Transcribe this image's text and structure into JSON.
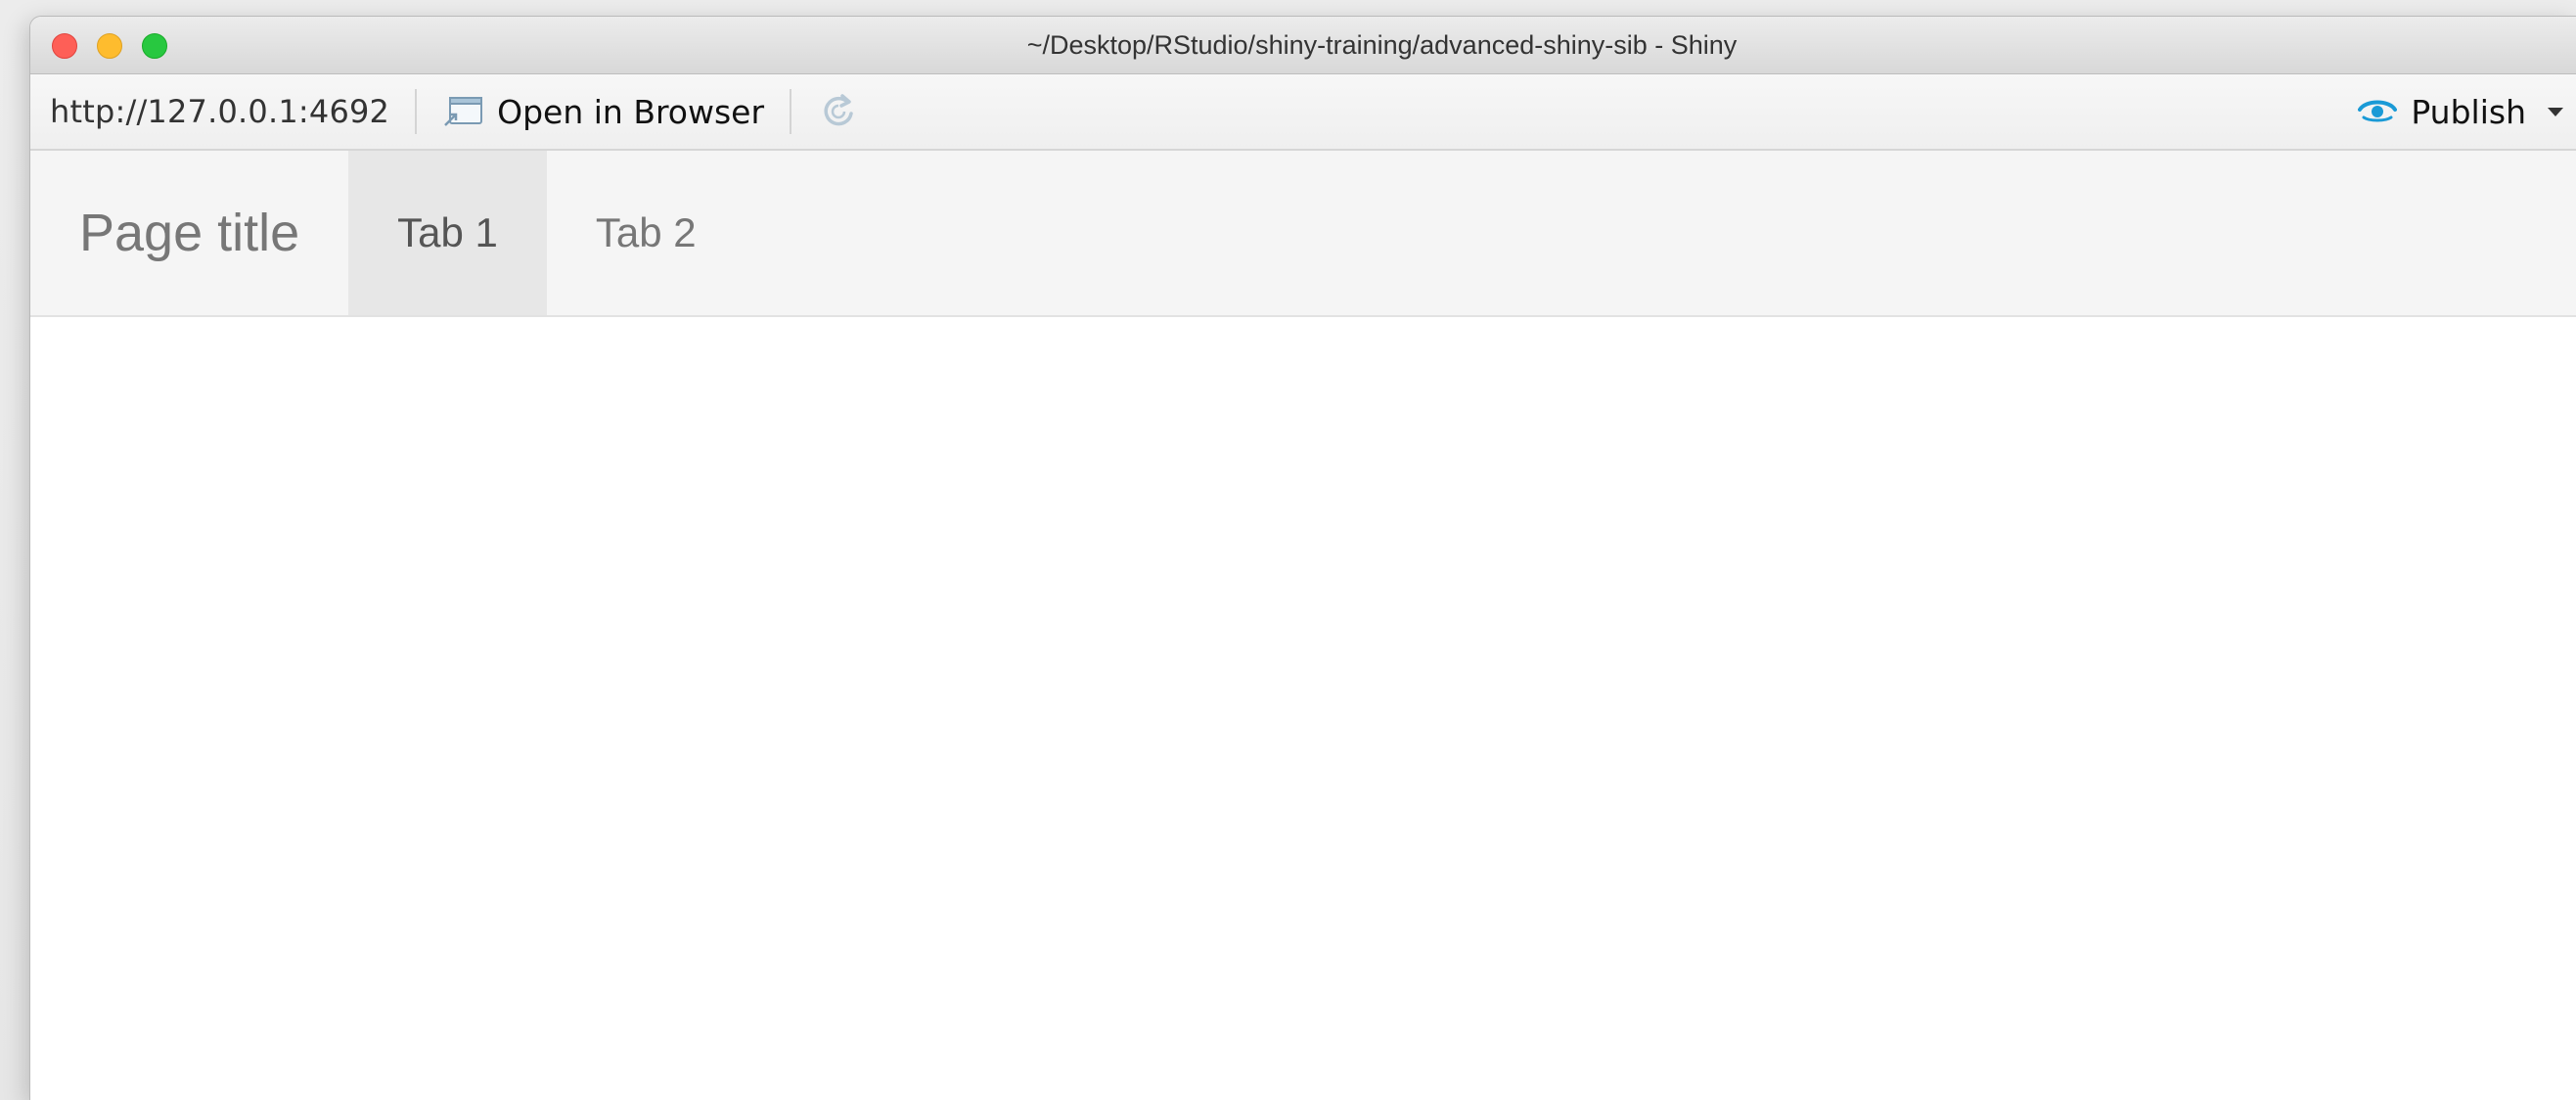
{
  "window": {
    "title": "~/Desktop/RStudio/shiny-training/advanced-shiny-sib - Shiny"
  },
  "toolbar": {
    "url": "http://127.0.0.1:4692",
    "open_in_browser_label": "Open in Browser",
    "publish_label": "Publish"
  },
  "navbar": {
    "brand": "Page title",
    "tabs": [
      {
        "label": "Tab 1",
        "active": true
      },
      {
        "label": "Tab 2",
        "active": false
      }
    ]
  },
  "colors": {
    "publish_accent": "#1a9ad6",
    "close": "#fe5f57",
    "minimize": "#febc2e",
    "maximize": "#28c840"
  },
  "icons": {
    "open_in_browser": "open-in-browser-icon",
    "refresh": "refresh-icon",
    "publish": "publish-icon",
    "caret": "chevron-down-icon"
  }
}
